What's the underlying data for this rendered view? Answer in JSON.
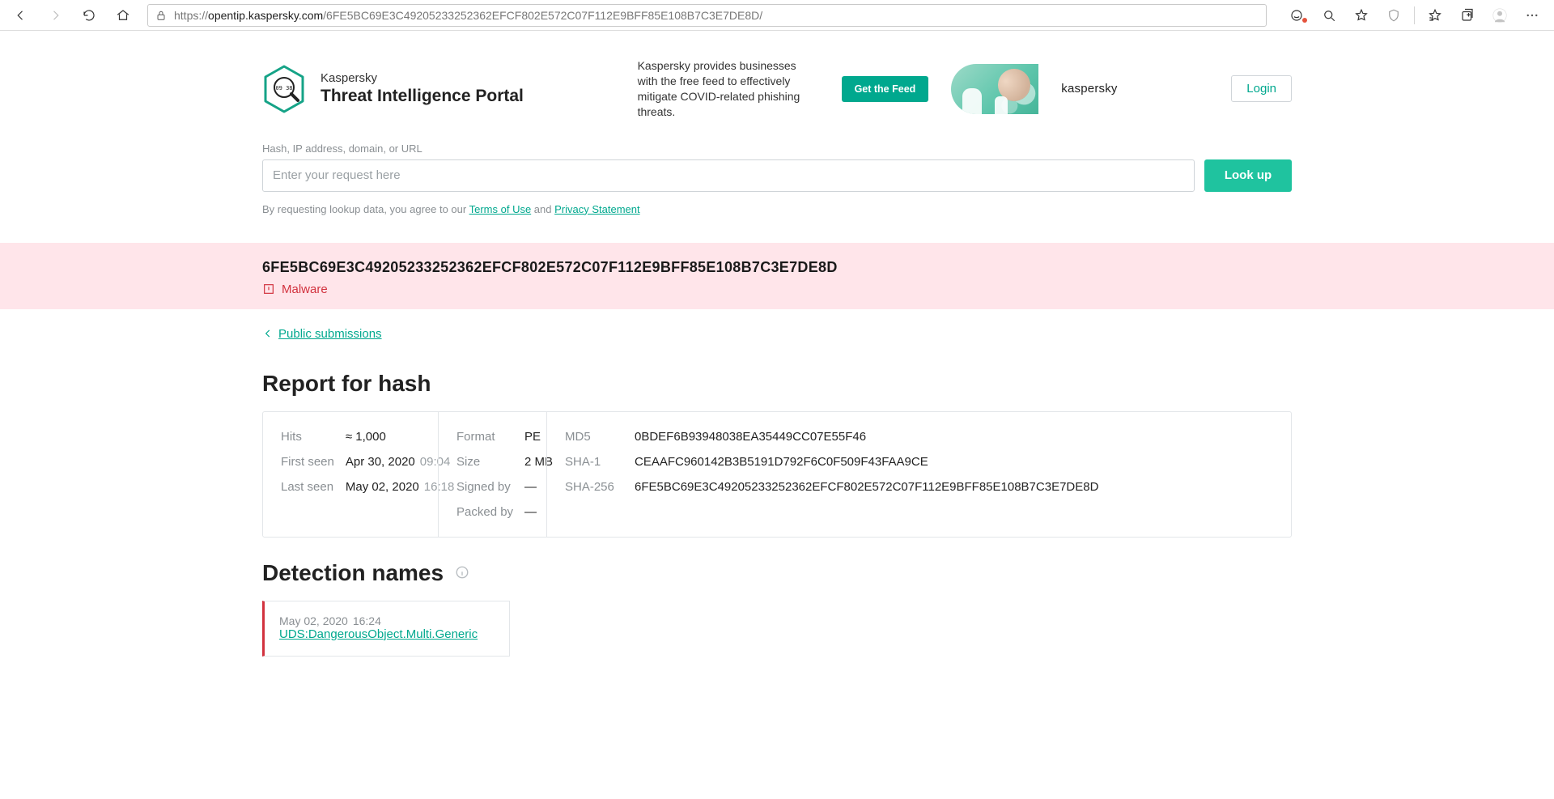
{
  "browser": {
    "url_prefix": "https://",
    "url_domain": "opentip.kaspersky.com",
    "url_path": "/6FE5BC69E3C49205233252362EFCF802E572C07F112E9BFF85E108B7C3E7DE8D/"
  },
  "header": {
    "brand_small": "Kaspersky",
    "brand_big": "Threat Intelligence Portal",
    "promo_copy": "Kaspersky provides businesses with the free feed to effectively mitigate COVID-related phishing threats.",
    "feed_btn": "Get the Feed",
    "kaspersky_word": "kaspersky",
    "login_btn": "Login"
  },
  "search": {
    "label": "Hash, IP address, domain, or URL",
    "placeholder": "Enter your request here",
    "lookup_btn": "Look up",
    "terms_prefix": "By requesting lookup data, you agree to our ",
    "terms_link": "Terms of Use",
    "terms_and": " and ",
    "privacy_link": "Privacy Statement"
  },
  "verdict": {
    "hash": "6FE5BC69E3C49205233252362EFCF802E572C07F112E9BFF85E108B7C3E7DE8D",
    "label": "Malware"
  },
  "crumbs": {
    "back_label": "Public submissions"
  },
  "report": {
    "title": "Report for hash",
    "col1": {
      "hits_k": "Hits",
      "hits_v": "≈ 1,000",
      "first_k": "First seen",
      "first_v": "Apr 30, 2020",
      "first_t": "09:04",
      "last_k": "Last seen",
      "last_v": "May 02, 2020",
      "last_t": "16:18"
    },
    "col2": {
      "format_k": "Format",
      "format_v": "PE",
      "size_k": "Size",
      "size_v": "2 MB",
      "signed_k": "Signed by",
      "signed_v": "—",
      "packed_k": "Packed by",
      "packed_v": "—"
    },
    "col3": {
      "md5_k": "MD5",
      "md5_v": "0BDEF6B93948038EA35449CC07E55F46",
      "sha1_k": "SHA-1",
      "sha1_v": "CEAAFC960142B3B5191D792F6C0F509F43FAA9CE",
      "sha256_k": "SHA-256",
      "sha256_v": "6FE5BC69E3C49205233252362EFCF802E572C07F112E9BFF85E108B7C3E7DE8D"
    }
  },
  "detections": {
    "title": "Detection names",
    "ts_date": "May 02, 2020",
    "ts_time": "16:24",
    "name": "UDS:DangerousObject.Multi.Generic"
  }
}
